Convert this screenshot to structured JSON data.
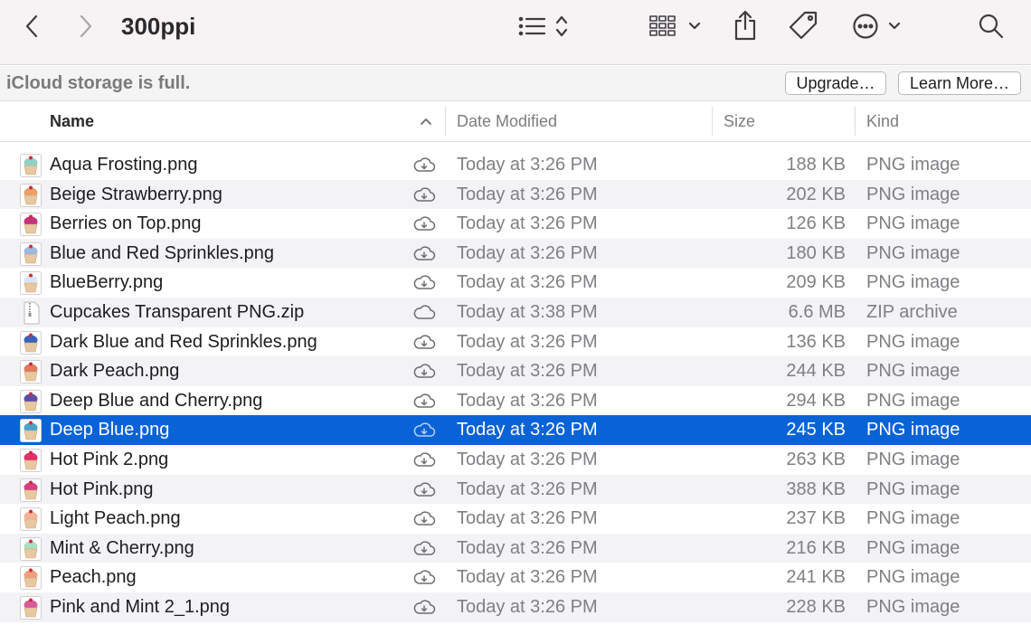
{
  "toolbar": {
    "folder_title": "300ppi",
    "icons": {
      "back": "chevron-left-icon",
      "forward": "chevron-right-icon",
      "list_view": "list-view-icon",
      "group_view": "icon-grid-icon",
      "share": "share-icon",
      "tag": "tag-icon",
      "more": "ellipsis-circle-icon",
      "search": "search-icon"
    }
  },
  "banner": {
    "message": "iCloud storage is full.",
    "upgrade_label": "Upgrade…",
    "learn_more_label": "Learn More…"
  },
  "columns": {
    "name": "Name",
    "date_modified": "Date Modified",
    "size": "Size",
    "kind": "Kind"
  },
  "colors": {
    "selection": "#0a63d6",
    "alt_row": "#f3f3f5",
    "toolbar_bg": "#f7f3f5"
  },
  "files": [
    {
      "name": "Aqua Frosting.png",
      "date": "Today at 3:26 PM",
      "size": "188 KB",
      "kind": "PNG image",
      "icon": "cupcake-icon",
      "frost": "#8fd3c7",
      "selected": false
    },
    {
      "name": "Beige Strawberry.png",
      "date": "Today at 3:26 PM",
      "size": "202 KB",
      "kind": "PNG image",
      "icon": "cupcake-icon",
      "frost": "#e8a06a",
      "selected": false
    },
    {
      "name": "Berries on Top.png",
      "date": "Today at 3:26 PM",
      "size": "126 KB",
      "kind": "PNG image",
      "icon": "cupcake-icon",
      "frost": "#c2337a",
      "selected": false
    },
    {
      "name": "Blue and Red Sprinkles.png",
      "date": "Today at 3:26 PM",
      "size": "180 KB",
      "kind": "PNG image",
      "icon": "cupcake-icon",
      "frost": "#9fb8e0",
      "selected": false
    },
    {
      "name": "BlueBerry.png",
      "date": "Today at 3:26 PM",
      "size": "209 KB",
      "kind": "PNG image",
      "icon": "cupcake-icon",
      "frost": "#d9e6f2",
      "selected": false
    },
    {
      "name": "Cupcakes Transparent PNG.zip",
      "date": "Today at 3:38 PM",
      "size": "6.6 MB",
      "kind": "ZIP archive",
      "icon": "zip-archive-icon",
      "frost": "#ffffff",
      "selected": false
    },
    {
      "name": "Dark Blue and Red Sprinkles.png",
      "date": "Today at 3:26 PM",
      "size": "136 KB",
      "kind": "PNG image",
      "icon": "cupcake-icon",
      "frost": "#3d62b8",
      "selected": false
    },
    {
      "name": "Dark Peach.png",
      "date": "Today at 3:26 PM",
      "size": "244 KB",
      "kind": "PNG image",
      "icon": "cupcake-icon",
      "frost": "#e07a5f",
      "selected": false
    },
    {
      "name": "Deep Blue and Cherry.png",
      "date": "Today at 3:26 PM",
      "size": "294 KB",
      "kind": "PNG image",
      "icon": "cupcake-icon",
      "frost": "#5b4fa8",
      "selected": false
    },
    {
      "name": "Deep Blue.png",
      "date": "Today at 3:26 PM",
      "size": "245 KB",
      "kind": "PNG image",
      "icon": "cupcake-icon",
      "frost": "#4aa3c8",
      "selected": true
    },
    {
      "name": "Hot Pink 2.png",
      "date": "Today at 3:26 PM",
      "size": "263 KB",
      "kind": "PNG image",
      "icon": "cupcake-icon",
      "frost": "#e0306a",
      "selected": false
    },
    {
      "name": "Hot Pink.png",
      "date": "Today at 3:26 PM",
      "size": "388 KB",
      "kind": "PNG image",
      "icon": "cupcake-icon",
      "frost": "#d4417f",
      "selected": false
    },
    {
      "name": "Light Peach.png",
      "date": "Today at 3:26 PM",
      "size": "237 KB",
      "kind": "PNG image",
      "icon": "cupcake-icon",
      "frost": "#f2b59a",
      "selected": false
    },
    {
      "name": "Mint & Cherry.png",
      "date": "Today at 3:26 PM",
      "size": "216 KB",
      "kind": "PNG image",
      "icon": "cupcake-icon",
      "frost": "#a8e0c0",
      "selected": false
    },
    {
      "name": "Peach.png",
      "date": "Today at 3:26 PM",
      "size": "241 KB",
      "kind": "PNG image",
      "icon": "cupcake-icon",
      "frost": "#f0a07c",
      "selected": false
    },
    {
      "name": "Pink and Mint 2_1.png",
      "date": "Today at 3:26 PM",
      "size": "228 KB",
      "kind": "PNG image",
      "icon": "cupcake-icon",
      "frost": "#d95a9a",
      "selected": false
    }
  ]
}
